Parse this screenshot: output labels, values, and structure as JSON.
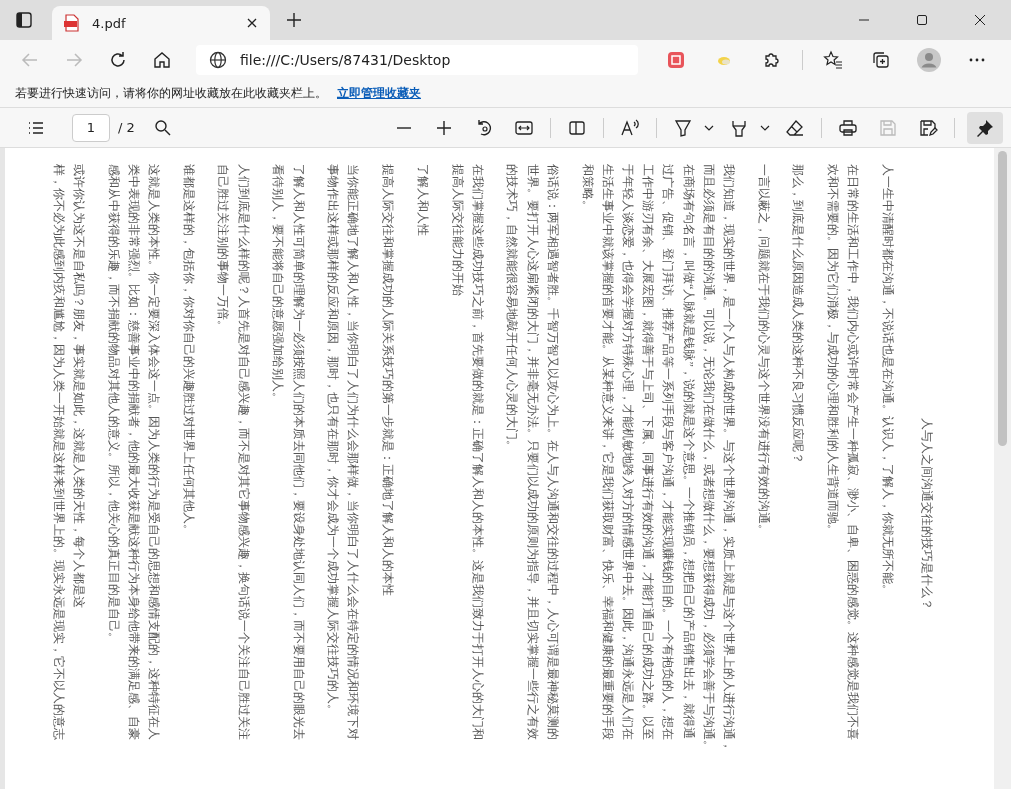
{
  "tabs": [
    {
      "title": "4.pdf",
      "selected": true
    }
  ],
  "address": "file:///C:/Users/87431/Desktop",
  "favorites_bar": {
    "message": "若要进行快速访问，请将你的网址收藏放在此收藏夹栏上。",
    "link": "立即管理收藏夹"
  },
  "pdf_toolbar": {
    "page": "1",
    "page_count": "/ 2"
  },
  "document": {
    "title": "人与人之间沟通交往的技巧是什么？",
    "paragraphs": [
      {
        "lines": [
          "人一生中清醒时都在沟通，不说话也是在沟通。认识人，了解人，你就无所不能。"
        ]
      },
      {
        "lines": [
          "在日常的生活和工作中，我们内心或许时常会产生一种孤寂、渺小、自卑、困惑的感觉。这种感觉是我们不喜",
          "欢和不需要的。因为它们消极，与成功的心理和胜利的人生背道而驰。"
        ]
      },
      {
        "lines": [
          "那么，到底是什么原因造成人类的这种不良习惯反应呢？"
        ]
      },
      {
        "lines": [
          "一言以蔽之，问题就在于我们的心灵与这个世界没有进行有效的沟通。"
        ]
      },
      {
        "lines": [
          "我们知道，现实的世界，是一个人与人构成的世界。与这个世界沟通，实质上就是与这个世界上的人进行沟通，",
          "而且必须是有目的的沟通。可以说，无论我们在做什么，或者想做什么，要想获得成功，必须学会善于与沟通。",
          "在商场有句名言，叫做“人脉就是钱脉”，说的就是这个意思。一个推销员，想把自己的产品销售出去，就得通",
          "过广告、促销、登门拜访、推荐产品等一系列手段与客户沟通，才能实现赚钱的目的。一个有抱负的人，想在",
          "工作中游刃有余、大展宏图，就得善于与上司、下属、同事进行有效的沟通，才能打通自己的成功之路。以至",
          "于年轻人谈恋爱，也得会学握对方特殊心理，才能机敏地跨入对方的情感世界中去。因此，沟通永远是人们在",
          "生活生事业中就该掌握的首要才能。从某种意义来讲，它是我们获取财富、快乐、幸福和健康的最重要的手段",
          "和策略。"
        ]
      },
      {
        "lines": [
          "俗话说：两军相遇智者胜。千智万智又以攻心为上。在人与人沟通和交往的过程中，人心可谓是最神秘莫测的",
          "世界。要打开人心这扇紧闭的大门，并非毫无办法。只要们以成功的原则为指导，并且切实掌握一些行之有效",
          "的技术巧，自然就能很容易地敲开任何人心灵的大门。"
        ]
      },
      {
        "lines": [
          "在我们掌握这些成功技巧之前，首先要做的就是：正确了解人和人的本性。这是我们致力于打开人心的大门和",
          "提高人际交往能力的开始"
        ]
      },
      {
        "lines": [
          "了解人和人性"
        ]
      },
      {
        "lines": [
          "提高人际交往和掌握成功的人际关系技巧的第一步就是：正确地了解人和人的本性"
        ]
      },
      {
        "lines": [
          "当你能正确地了解人和人性，当你明白了人们为什么会那样做，当你明白了人什么会在特定的情况和环境下对",
          "事物作出这样或那样的反应和原因，那时，也只有在那时，你才会成为一个成功掌握人际交往技巧的人。"
        ]
      },
      {
        "lines": [
          "了解人和人性可简单的理解为一必须按照人们的本质去同他们，要设身处地认同人们，而不要用自己的眼光去",
          "看待别人，要不能将自己的意愿强加给别人。"
        ]
      },
      {
        "lines": [
          "人们到底是什么样的呢？人首先是对自己感兴趣，而不是对其它事物感兴趣，换句话说一个关注自己胜过关注",
          "自己胜过关注别的事物一万倍。"
        ]
      },
      {
        "lines": [
          "谁都是这样的，包括你，你对你自己的兴趣胜过对世界上任何其他人。"
        ]
      },
      {
        "lines": [
          "这就是人类的本性。你一定要深入体会这一点。因为人类的行为是受自己的思想和感情支配的，这种特征在人",
          "类中表现的非常强烈。比如：慈善事业中的捐献者，他的最大收获是献这种行为本身给他带来的满足感、自豪",
          "感和从中获得的乐趣，而不捐献的物品对其他人的意义。所以，他关心的真正目的是自己。"
        ]
      },
      {
        "lines": [
          "或许你认为这不是自私吗？朋友，事实就是如此，这就是人类的天性，每个人都是这",
          "样，你不必为此感到内疚和尴尬，因为人类一开始就是这样来到世界上的。现实永远是现实，它不以人的意志"
        ]
      }
    ]
  }
}
